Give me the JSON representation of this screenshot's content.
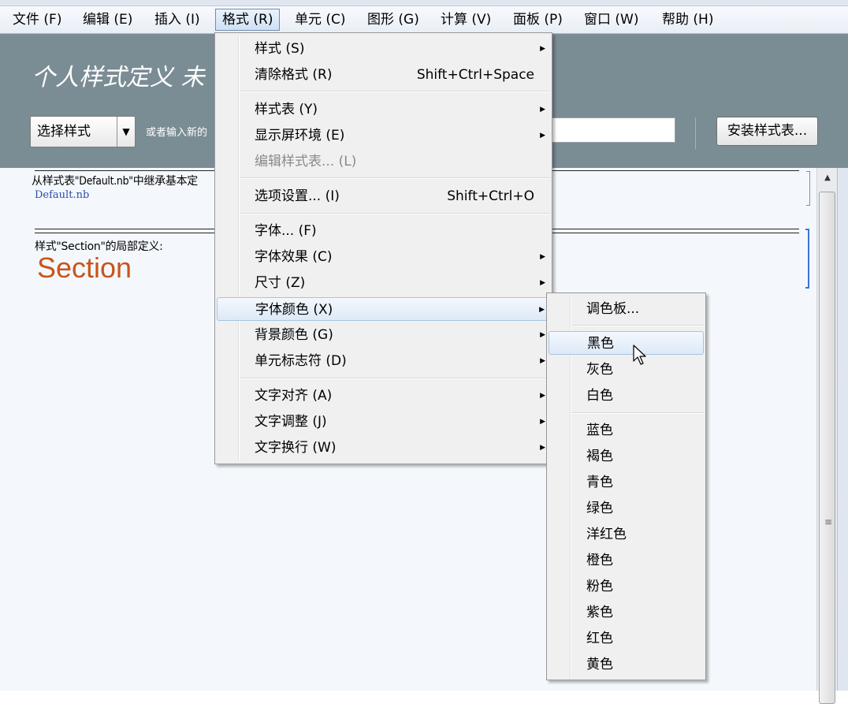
{
  "menubar": {
    "items": [
      {
        "label": "文件 (F)"
      },
      {
        "label": "编辑 (E)"
      },
      {
        "label": "插入 (I)"
      },
      {
        "label": "格式 (R)"
      },
      {
        "label": "单元 (C)"
      },
      {
        "label": "图形 (G)"
      },
      {
        "label": "计算 (V)"
      },
      {
        "label": "面板 (P)"
      },
      {
        "label": "窗口 (W)"
      },
      {
        "label": "帮助 (H)"
      }
    ]
  },
  "header": {
    "title": "个人样式定义 未",
    "select_label": "选择样式",
    "hint": "或者输入新的",
    "install_button": "安装样式表..."
  },
  "document": {
    "inherit_text": "从样式表\"Default.nb\"中继承基本定",
    "inherit_link": "Default.nb",
    "local_text": "样式\"Section\"的局部定义:",
    "section_sample": "Section"
  },
  "format_menu": {
    "items": [
      {
        "label": "样式 (S)",
        "shortcut": "",
        "submenu": true
      },
      {
        "label": "清除格式 (R)",
        "shortcut": "Shift+Ctrl+Space",
        "submenu": false
      },
      {
        "label": "样式表 (Y)",
        "shortcut": "",
        "submenu": true
      },
      {
        "label": "显示屏环境 (E)",
        "shortcut": "",
        "submenu": true
      },
      {
        "label": "编辑样式表... (L)",
        "shortcut": "",
        "submenu": false,
        "disabled": true
      },
      {
        "label": "选项设置... (I)",
        "shortcut": "Shift+Ctrl+O",
        "submenu": false
      },
      {
        "label": "字体... (F)",
        "shortcut": "",
        "submenu": false
      },
      {
        "label": "字体效果 (C)",
        "shortcut": "",
        "submenu": true
      },
      {
        "label": "尺寸 (Z)",
        "shortcut": "",
        "submenu": true
      },
      {
        "label": "字体颜色 (X)",
        "shortcut": "",
        "submenu": true,
        "highlighted": true
      },
      {
        "label": "背景颜色 (G)",
        "shortcut": "",
        "submenu": true
      },
      {
        "label": "单元标志符 (D)",
        "shortcut": "",
        "submenu": true
      },
      {
        "label": "文字对齐 (A)",
        "shortcut": "",
        "submenu": true
      },
      {
        "label": "文字调整 (J)",
        "shortcut": "",
        "submenu": true
      },
      {
        "label": "文字换行 (W)",
        "shortcut": "",
        "submenu": true
      }
    ]
  },
  "color_menu": {
    "items": [
      {
        "label": "调色板..."
      },
      {
        "label": "黑色",
        "highlighted": true
      },
      {
        "label": "灰色"
      },
      {
        "label": "白色"
      },
      {
        "label": "蓝色"
      },
      {
        "label": "褐色"
      },
      {
        "label": "青色"
      },
      {
        "label": "绿色"
      },
      {
        "label": "洋红色"
      },
      {
        "label": "橙色"
      },
      {
        "label": "粉色"
      },
      {
        "label": "紫色"
      },
      {
        "label": "红色"
      },
      {
        "label": "黄色"
      }
    ]
  },
  "icons": {
    "submenu_arrow": "triangle-right-icon",
    "dropdown_arrow": "triangle-down-icon",
    "scroll_up": "triangle-up-icon",
    "cursor": "mouse-pointer-icon"
  }
}
